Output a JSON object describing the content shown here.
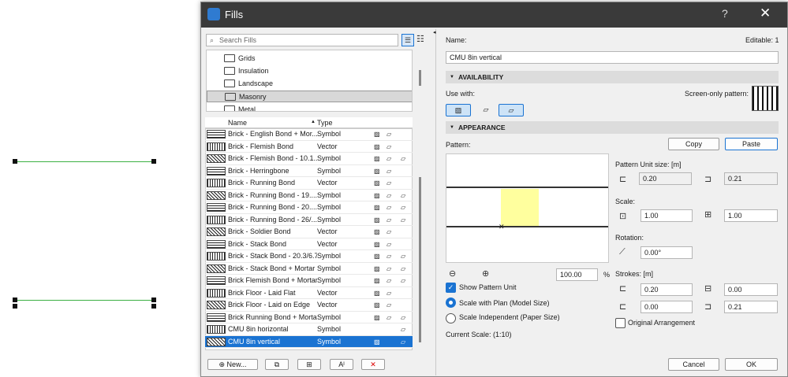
{
  "dialog": {
    "title": "Fills",
    "help": "?",
    "close": "✕"
  },
  "search": {
    "placeholder": "Search Fills"
  },
  "folders": [
    "Grids",
    "Insulation",
    "Landscape",
    "Masonry",
    "Metal"
  ],
  "list": {
    "col_name": "Name",
    "col_type": "Type",
    "sort": "▲",
    "rows": [
      {
        "name": "Brick - English Bond + Mor...",
        "type": "Symbol",
        "i1": "▨",
        "i2": "▱",
        "i3": ""
      },
      {
        "name": "Brick - Flemish Bond",
        "type": "Vector",
        "i1": "▨",
        "i2": "▱",
        "i3": ""
      },
      {
        "name": "Brick - Flemish Bond - 10.1...",
        "type": "Symbol",
        "i1": "▨",
        "i2": "▱",
        "i3": "▱"
      },
      {
        "name": "Brick - Herringbone",
        "type": "Symbol",
        "i1": "▨",
        "i2": "▱",
        "i3": ""
      },
      {
        "name": "Brick - Running Bond",
        "type": "Vector",
        "i1": "▨",
        "i2": "▱",
        "i3": ""
      },
      {
        "name": "Brick - Running Bond - 19....",
        "type": "Symbol",
        "i1": "▨",
        "i2": "▱",
        "i3": "▱"
      },
      {
        "name": "Brick - Running Bond - 20....",
        "type": "Symbol",
        "i1": "▨",
        "i2": "▱",
        "i3": "▱"
      },
      {
        "name": "Brick - Running Bond - 26/...",
        "type": "Symbol",
        "i1": "▨",
        "i2": "▱",
        "i3": "▱"
      },
      {
        "name": "Brick - Soldier Bond",
        "type": "Vector",
        "i1": "▨",
        "i2": "▱",
        "i3": ""
      },
      {
        "name": "Brick - Stack Bond",
        "type": "Vector",
        "i1": "▨",
        "i2": "▱",
        "i3": ""
      },
      {
        "name": "Brick - Stack Bond - 20.3/6.76",
        "type": "Symbol",
        "i1": "▨",
        "i2": "▱",
        "i3": "▱"
      },
      {
        "name": "Brick - Stack Bond + Mortar",
        "type": "Symbol",
        "i1": "▨",
        "i2": "▱",
        "i3": "▱"
      },
      {
        "name": "Brick Flemish Bond + Mortar",
        "type": "Symbol",
        "i1": "▨",
        "i2": "▱",
        "i3": "▱"
      },
      {
        "name": "Brick Floor - Laid Flat",
        "type": "Vector",
        "i1": "▨",
        "i2": "▱",
        "i3": ""
      },
      {
        "name": "Brick Floor - Laid on Edge",
        "type": "Vector",
        "i1": "▨",
        "i2": "▱",
        "i3": ""
      },
      {
        "name": "Brick Running Bond + Mortar",
        "type": "Symbol",
        "i1": "▨",
        "i2": "▱",
        "i3": "▱"
      },
      {
        "name": "CMU 8in horizontal",
        "type": "Symbol",
        "i1": "",
        "i2": "",
        "i3": "▱"
      },
      {
        "name": "CMU 8in vertical",
        "type": "Symbol",
        "i1": "▨",
        "i2": "",
        "i3": "▱"
      }
    ]
  },
  "bottom_left": {
    "new": "New...",
    "duplicate_icon": "⧉",
    "append_icon": "⊞",
    "rename_icon": "Aᴵ",
    "delete_icon": "✕"
  },
  "right": {
    "name_label": "Name:",
    "editable": "Editable: 1",
    "name_value": "CMU 8in vertical",
    "availability": "AVAILABILITY",
    "use_with": "Use with:",
    "screen_only": "Screen-only pattern:",
    "appearance": "APPEARANCE",
    "pattern": "Pattern:",
    "copy": "Copy",
    "paste": "Paste",
    "unit_size": "Pattern Unit size: [m]",
    "unit_w": "0.20",
    "unit_h": "0.21",
    "scale": "Scale:",
    "scale_x": "1.00",
    "scale_y": "1.00",
    "rotation": "Rotation:",
    "rotation_val": "0.00°",
    "zoom": "100.00",
    "pct": "%",
    "show_unit": "Show Pattern Unit",
    "scale_plan": "Scale with Plan (Model Size)",
    "scale_indep": "Scale Independent (Paper Size)",
    "strokes": "Strokes: [m]",
    "s1": "0.20",
    "s2": "0.00",
    "s3": "0.00",
    "s4": "0.21",
    "orig": "Original Arrangement",
    "current": "Current Scale: (1:10)",
    "cancel": "Cancel",
    "ok": "OK"
  },
  "colors": {
    "accent": "#1a73d2",
    "titlebar": "#3a3a3a",
    "line": "#3cb043",
    "preview": "#ffff9e"
  }
}
